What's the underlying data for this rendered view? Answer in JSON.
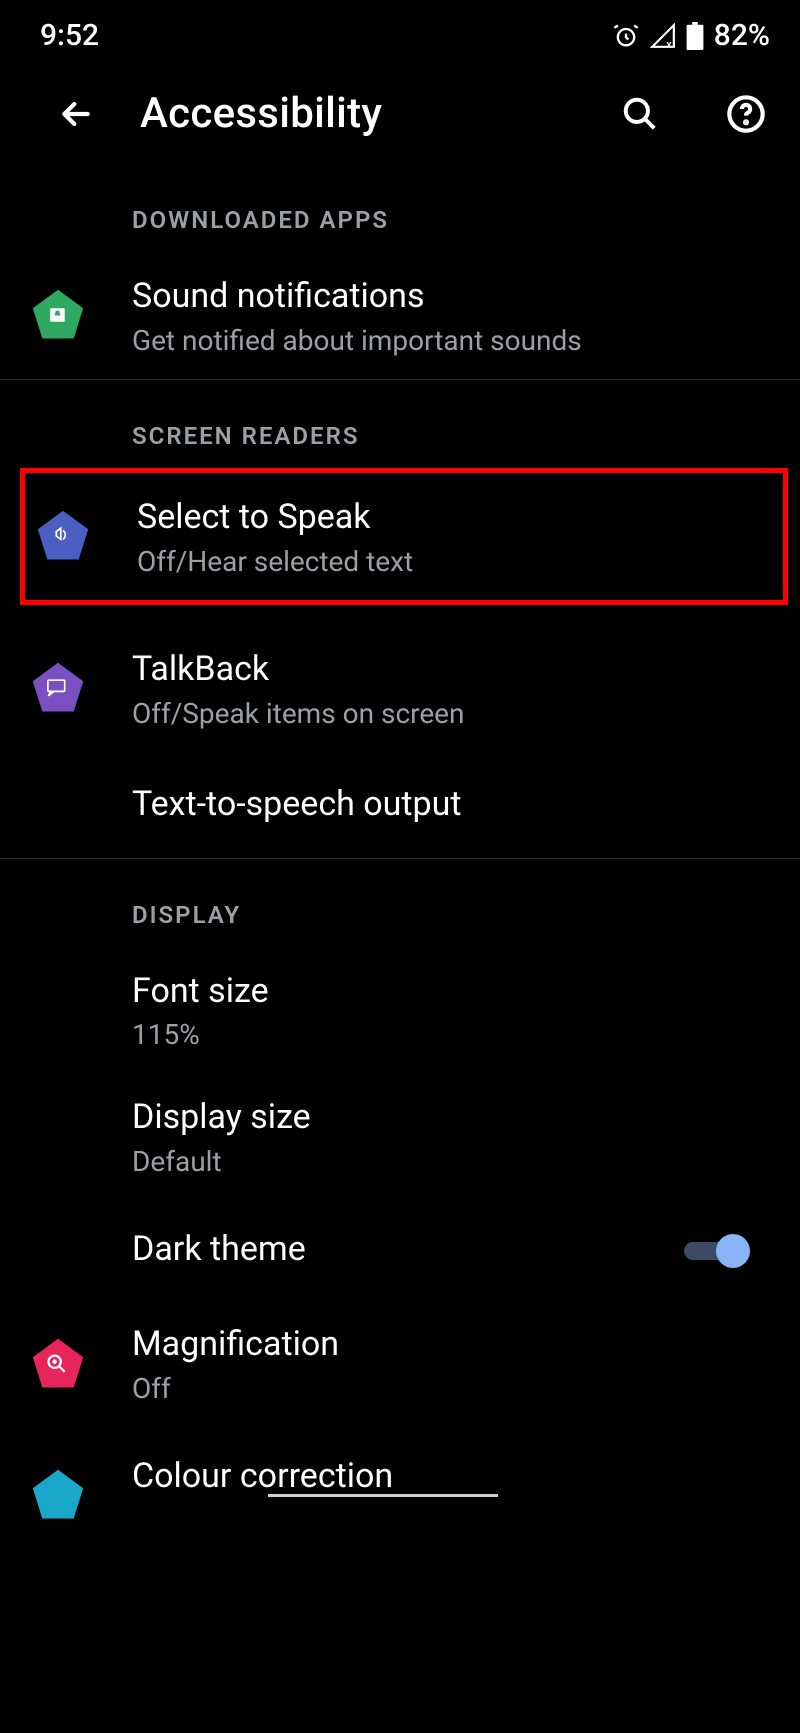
{
  "status": {
    "time": "9:52",
    "battery": "82%"
  },
  "header": {
    "title": "Accessibility"
  },
  "sections": {
    "downloaded_apps": "DOWNLOADED APPS",
    "screen_readers": "SCREEN READERS",
    "display": "DISPLAY"
  },
  "items": {
    "sound_notifications": {
      "title": "Sound notifications",
      "subtitle": "Get notified about important sounds"
    },
    "select_to_speak": {
      "title": "Select to Speak",
      "subtitle": "Off/Hear selected text"
    },
    "talkback": {
      "title": "TalkBack",
      "subtitle": "Off/Speak items on screen"
    },
    "tts": {
      "title": "Text-to-speech output"
    },
    "font_size": {
      "title": "Font size",
      "subtitle": "115%"
    },
    "display_size": {
      "title": "Display size",
      "subtitle": "Default"
    },
    "dark_theme": {
      "title": "Dark theme",
      "state": "on"
    },
    "magnification": {
      "title": "Magnification",
      "subtitle": "Off"
    },
    "colour_correction": {
      "title": "Colour correction"
    }
  },
  "icons": {
    "sound_notifications_color": "#2fa860",
    "select_to_speak_color": "#4a5fc1",
    "talkback_color": "#7a4fc1",
    "magnification_color": "#e6265a",
    "colour_correction_color": "#1aa8c9"
  }
}
